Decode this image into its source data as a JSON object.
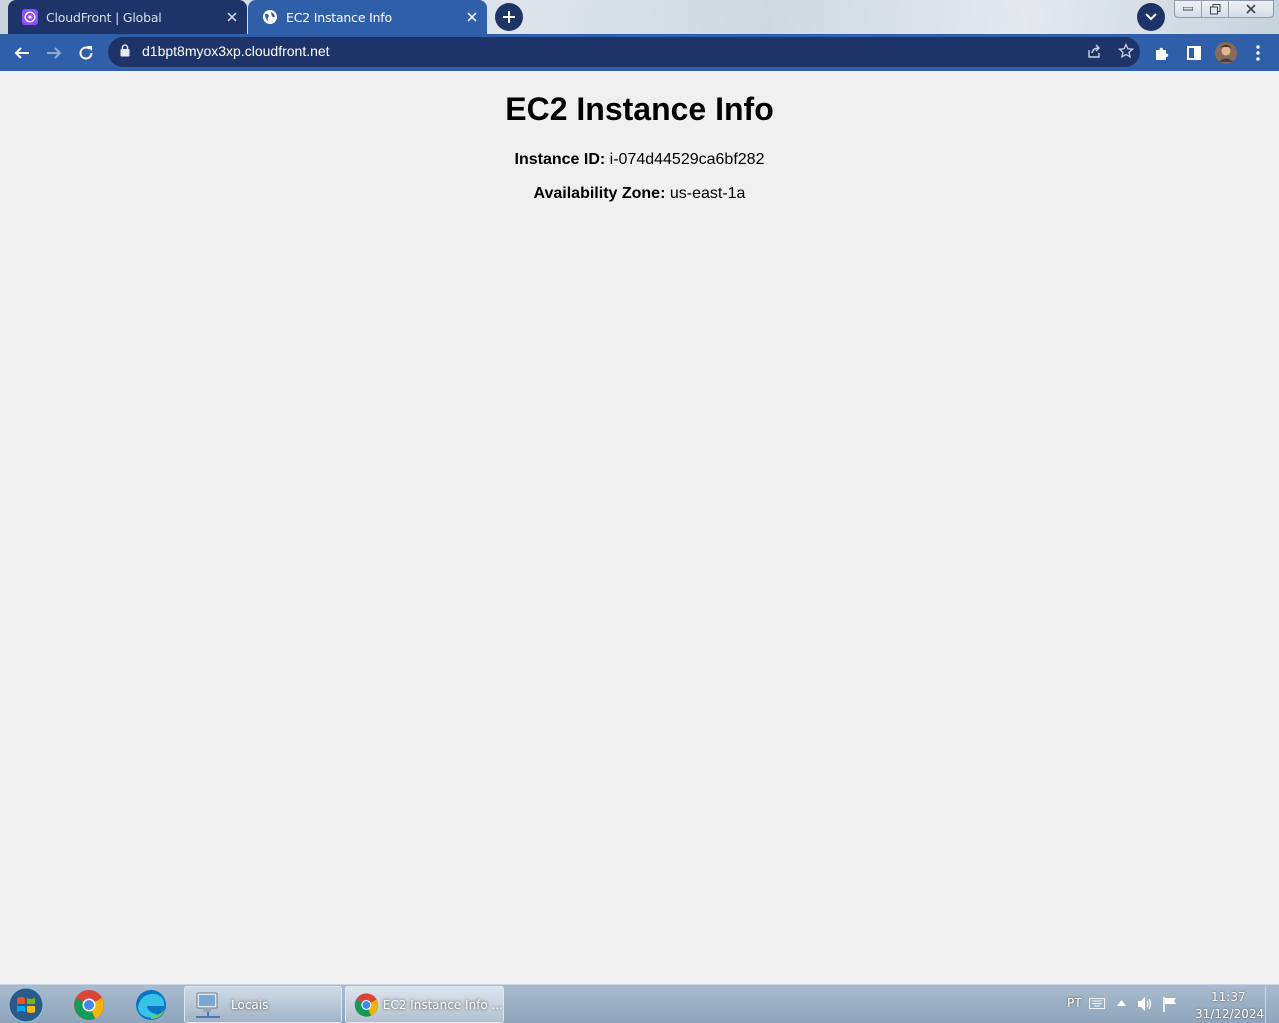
{
  "browser": {
    "tabs": [
      {
        "title": "CloudFront | Global",
        "icon": "cloudfront-icon",
        "active": false
      },
      {
        "title": "EC2 Instance Info",
        "icon": "globe-icon",
        "active": true
      }
    ],
    "url": "d1bpt8myox3xp.cloudfront.net",
    "colors": {
      "frame": "#1e3468",
      "active": "#2f5fa8"
    }
  },
  "page": {
    "heading": "EC2 Instance Info",
    "fields": [
      {
        "label": "Instance ID:",
        "value": "i-074d44529ca6bf282"
      },
      {
        "label": "Availability Zone:",
        "value": "us-east-1a"
      }
    ]
  },
  "taskbar": {
    "pinned": [
      "chrome-icon",
      "edge-icon"
    ],
    "windows": [
      {
        "label": "Locais",
        "icon": "network-computer-icon"
      },
      {
        "label": "EC2 Instance Info ...",
        "icon": "chrome-icon"
      }
    ],
    "tray": {
      "language": "PT",
      "time": "11:37",
      "date": "31/12/2024"
    }
  }
}
